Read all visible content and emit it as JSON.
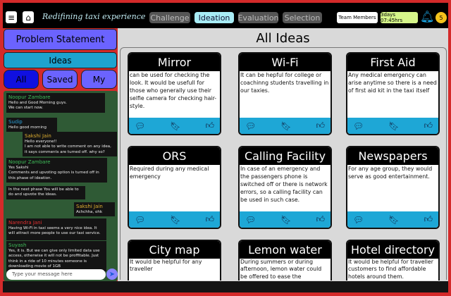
{
  "header": {
    "title": "Redifining taxi experience",
    "phases": [
      "Challenge",
      "Ideation",
      "Evaluation",
      "Selection"
    ],
    "active_phase": "Ideation",
    "team_members": "Team Members",
    "timer": "3days 07:45hrs",
    "notifications": "5"
  },
  "sidebar": {
    "problem_statement": "Problem Statement",
    "ideas": "Ideas",
    "filters": [
      "All",
      "Saved",
      "My"
    ],
    "active_filter": "All"
  },
  "chat": {
    "messages": [
      {
        "author": "Noopur Zambare",
        "color": "#3fbf5a",
        "text": "Hello and Good Morning guys.\nWe can start now."
      },
      {
        "author": "Sudip",
        "color": "#2aa0d8",
        "text": "Hello good morning"
      },
      {
        "author": "Sakshi Jain",
        "color": "#e0b030",
        "text": "Hello everyone!!\nI am not able to write comment on any idea, it says comments are turned off. why so?"
      },
      {
        "author": "Noopur Zambare",
        "color": "#3fbf5a",
        "text": "Yes Sakshi\nComments and upvoting option is turned off in this phase of ideation."
      },
      {
        "author": "",
        "color": "",
        "text": "In the next phase You will be able to do and upvote the ideas."
      },
      {
        "author": "Sakshi Jain",
        "color": "#e0b030",
        "text": "Achchha, ohk"
      },
      {
        "author": "Narendra Jani",
        "color": "#e03030",
        "text": "Having Wi-Fi in taxi seems a very nice idea. It will attract more people to use our taxi service."
      },
      {
        "author": "Suyash",
        "color": "#3fbf5a",
        "text": "Yes, it is. But we can give only limited data use access, otherwise it will not be proffitable. Just think in a ride of 10 minutes someone is downloading movie of 1GB"
      }
    ],
    "input_placeholder": "Type your message here"
  },
  "main": {
    "title": "All Ideas",
    "ideas": [
      {
        "title": "Mirror",
        "text": "can be used for checking the look. It would be usefull for those who generally use their selfie camera for checking hair-style."
      },
      {
        "title": "Wi-Fi",
        "text": "It can be hepful for college or coachinng students travelling in our taxies."
      },
      {
        "title": "First Aid",
        "text": "Any medical emergency can arise anytime so there is a need of first aid kit in the taxi itself"
      },
      {
        "title": "ORS",
        "text": "Required during any medical emergency"
      },
      {
        "title": "Calling Facility",
        "text": "In case of an emergency and the passengers phone is switched off or there is network errors, so a calling facility can be used in such case."
      },
      {
        "title": "Newspapers",
        "text": "For any age group, they would serve as good entertainment."
      },
      {
        "title": "City map",
        "text": "It would be helpful for any traveller"
      },
      {
        "title": "Lemon water",
        "text": "During summers or during afternoon, lemon water could be offered to ease the"
      },
      {
        "title": "Hotel directory",
        "text": "It would be helpful for traveller customers to find affordable hotels around them."
      }
    ]
  }
}
